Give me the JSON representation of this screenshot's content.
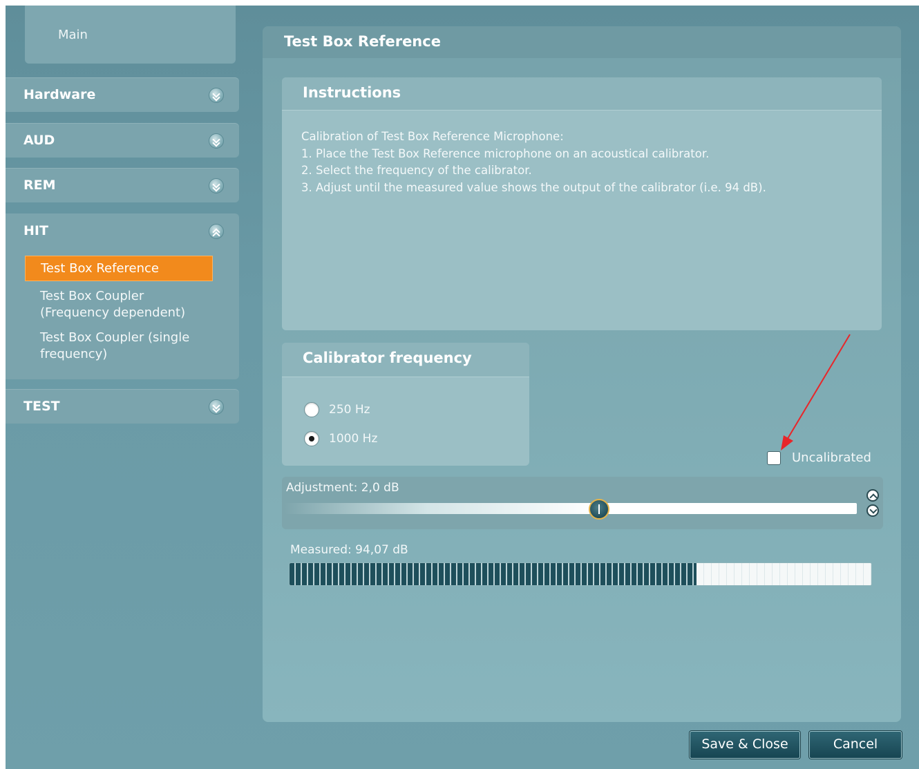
{
  "sidebar": {
    "main_label": "Main",
    "groups": [
      {
        "label": "Hardware",
        "expanded": false
      },
      {
        "label": "AUD",
        "expanded": false
      },
      {
        "label": "REM",
        "expanded": false
      },
      {
        "label": "HIT",
        "expanded": true,
        "items": [
          "Test Box Reference",
          "Test Box Coupler (Frequency dependent)",
          "Test Box Coupler (single frequency)"
        ]
      },
      {
        "label": "TEST",
        "expanded": false
      }
    ],
    "hit_items": {
      "active": "Test Box Reference",
      "item2_line1": "Test Box Coupler",
      "item2_line2": "(Frequency dependent)",
      "item3_line1": "Test Box Coupler (single",
      "item3_line2": "frequency)"
    }
  },
  "panel": {
    "title": "Test Box Reference",
    "instructions": {
      "title": "Instructions",
      "lines": [
        "Calibration of Test Box Reference Microphone:",
        "1. Place the Test Box Reference microphone on an acoustical calibrator.",
        "2. Select the frequency of the calibrator.",
        "3. Adjust until the measured value shows the output of the calibrator (i.e. 94 dB)."
      ]
    },
    "calibrator": {
      "title": "Calibrator frequency",
      "options": [
        "250 Hz",
        "1000 Hz"
      ],
      "selected": "1000 Hz"
    },
    "uncalibrated_label": "Uncalibrated",
    "uncalibrated_checked": false,
    "adjustment_label": "Adjustment: 2,0 dB",
    "adjustment_slider_fraction": 0.55,
    "measured_label": "Measured: 94,07 dB",
    "measured_fill_fraction": 0.7
  },
  "buttons": {
    "save_close": "Save & Close",
    "cancel": "Cancel"
  },
  "colors": {
    "active_item": "#f28a1c",
    "annotation_arrow": "#e8262a"
  }
}
